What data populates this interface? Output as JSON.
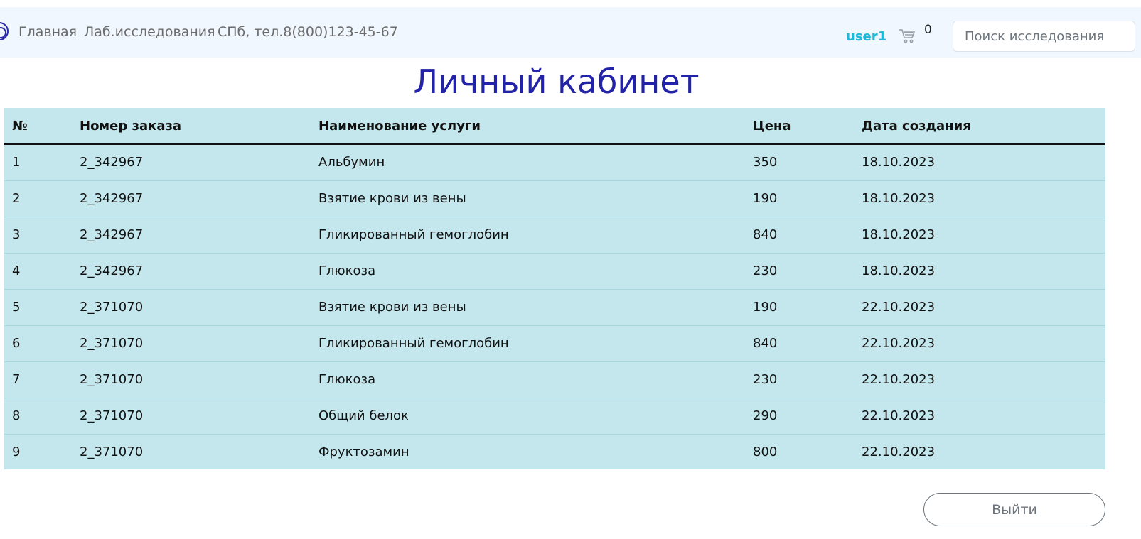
{
  "nav": {
    "home": "Главная",
    "lab": "Лаб.исследования",
    "info": "СПб, тел.8(800)123-45-67",
    "user": "user1",
    "cart_count": "0",
    "search_placeholder": "Поиск исследования"
  },
  "page_title": "Личный кабинет",
  "table": {
    "headers": [
      "№",
      "Номер заказа",
      "Наименование услуги",
      "Цена",
      "Дата создания"
    ],
    "rows": [
      [
        "1",
        "2_342967",
        "Альбумин",
        "350",
        "18.10.2023"
      ],
      [
        "2",
        "2_342967",
        "Взятие крови из вены",
        "190",
        "18.10.2023"
      ],
      [
        "3",
        "2_342967",
        "Гликированный гемоглобин",
        "840",
        "18.10.2023"
      ],
      [
        "4",
        "2_342967",
        "Глюкоза",
        "230",
        "18.10.2023"
      ],
      [
        "5",
        "2_371070",
        "Взятие крови из вены",
        "190",
        "22.10.2023"
      ],
      [
        "6",
        "2_371070",
        "Гликированный гемоглобин",
        "840",
        "22.10.2023"
      ],
      [
        "7",
        "2_371070",
        "Глюкоза",
        "230",
        "22.10.2023"
      ],
      [
        "8",
        "2_371070",
        "Общий белок",
        "290",
        "22.10.2023"
      ],
      [
        "9",
        "2_371070",
        "Фруктозамин",
        "800",
        "22.10.2023"
      ]
    ]
  },
  "logout_label": "Выйти",
  "colors": {
    "title": "#2323a8",
    "user_link": "#1fb8d8",
    "table_bg": "#c4e7ee",
    "navbar_bg": "#f0f7fe"
  },
  "icons": {
    "logo": "logo-icon",
    "cart": "cart-icon"
  }
}
